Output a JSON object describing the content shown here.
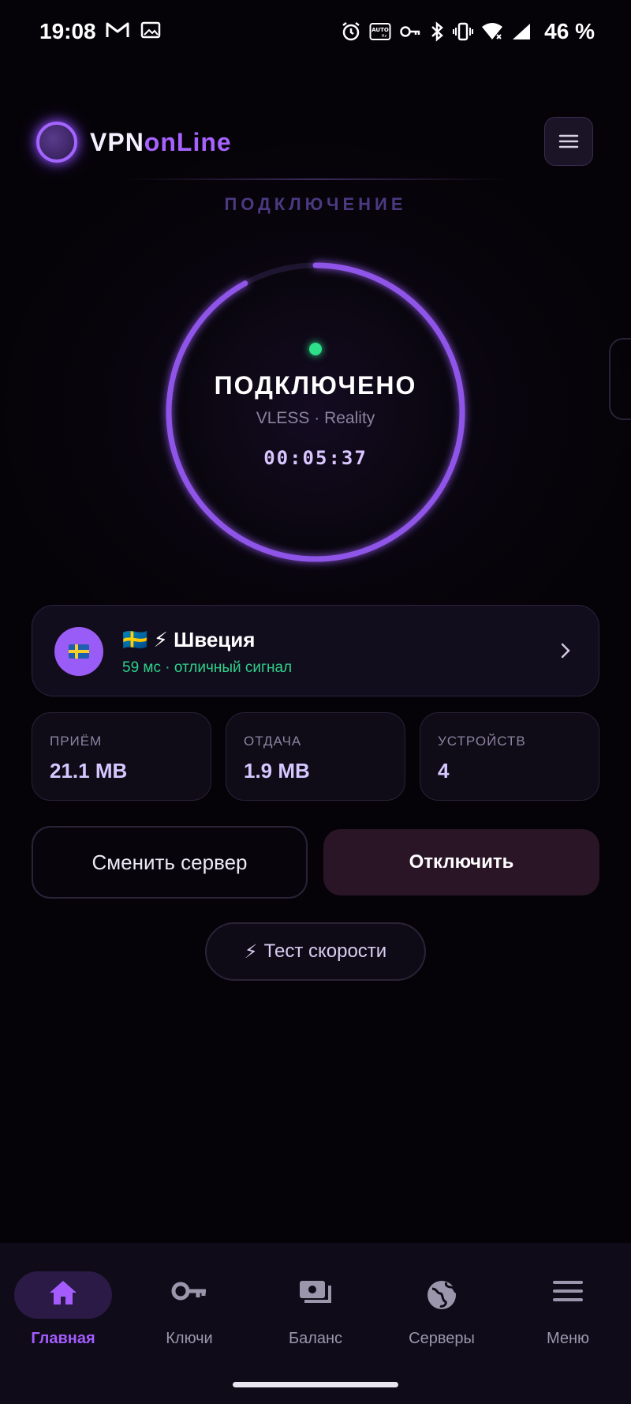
{
  "status_bar": {
    "time": "19:08",
    "battery": "46 %",
    "left_icons": [
      "gmail-icon",
      "gallery-icon"
    ],
    "right_icons": [
      "alarm-icon",
      "auto-hz-icon",
      "vpn-key-icon",
      "bluetooth-icon",
      "vibrate-icon",
      "wifi-icon",
      "signal-icon"
    ]
  },
  "header": {
    "logo_part1": "VPN",
    "logo_part2": "onLine",
    "section_title": "ПОДКЛЮЧЕНИЕ"
  },
  "connection": {
    "status": "ПОДКЛЮЧЕНО",
    "protocol": "VLESS · Reality",
    "timer": "00:05:37",
    "ring_fill": 0.92,
    "dot_color": "#2ee08a"
  },
  "server": {
    "flag": "🇸🇪",
    "name": "🇸🇪  ⚡ Швеция",
    "subtitle": "59 мс · отличный сигнал"
  },
  "stats": [
    {
      "label": "ПРИЁМ",
      "value": "21.1 MB"
    },
    {
      "label": "ОТДАЧА",
      "value": "1.9 MB"
    },
    {
      "label": "УСТРОЙСТВ",
      "value": "4"
    }
  ],
  "actions": {
    "change_server": "Сменить сервер",
    "disconnect": "Отключить",
    "speed_test_icon": "⚡",
    "speed_test": "Тест скорости"
  },
  "nav": [
    {
      "label": "Главная",
      "icon": "home-icon",
      "active": true
    },
    {
      "label": "Ключи",
      "icon": "key-icon",
      "active": false
    },
    {
      "label": "Баланс",
      "icon": "wallet-icon",
      "active": false
    },
    {
      "label": "Серверы",
      "icon": "globe-icon",
      "active": false
    },
    {
      "label": "Меню",
      "icon": "menu-icon",
      "active": false
    }
  ],
  "colors": {
    "accent": "#a45cff",
    "background": "#050308",
    "success": "#2ed18a",
    "disconnect_bg": "#2a1527"
  }
}
